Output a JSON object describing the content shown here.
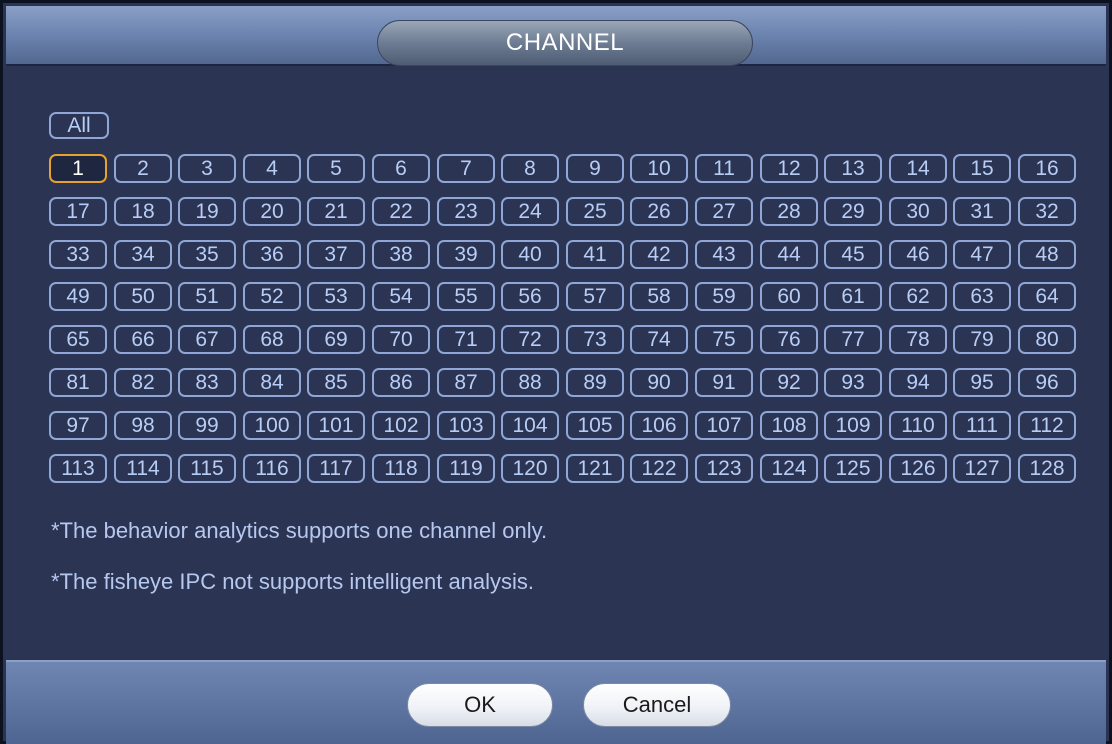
{
  "dialog": {
    "title": "CHANNEL"
  },
  "channels": {
    "all_label": "All",
    "selected": "1",
    "labels": [
      "1",
      "2",
      "3",
      "4",
      "5",
      "6",
      "7",
      "8",
      "9",
      "10",
      "11",
      "12",
      "13",
      "14",
      "15",
      "16",
      "17",
      "18",
      "19",
      "20",
      "21",
      "22",
      "23",
      "24",
      "25",
      "26",
      "27",
      "28",
      "29",
      "30",
      "31",
      "32",
      "33",
      "34",
      "35",
      "36",
      "37",
      "38",
      "39",
      "40",
      "41",
      "42",
      "43",
      "44",
      "45",
      "46",
      "47",
      "48",
      "49",
      "50",
      "51",
      "52",
      "53",
      "54",
      "55",
      "56",
      "57",
      "58",
      "59",
      "60",
      "61",
      "62",
      "63",
      "64",
      "65",
      "66",
      "67",
      "68",
      "69",
      "70",
      "71",
      "72",
      "73",
      "74",
      "75",
      "76",
      "77",
      "78",
      "79",
      "80",
      "81",
      "82",
      "83",
      "84",
      "85",
      "86",
      "87",
      "88",
      "89",
      "90",
      "91",
      "92",
      "93",
      "94",
      "95",
      "96",
      "97",
      "98",
      "99",
      "100",
      "101",
      "102",
      "103",
      "104",
      "105",
      "106",
      "107",
      "108",
      "109",
      "110",
      "111",
      "112",
      "113",
      "114",
      "115",
      "116",
      "117",
      "118",
      "119",
      "120",
      "121",
      "122",
      "123",
      "124",
      "125",
      "126",
      "127",
      "128"
    ]
  },
  "notes": {
    "behavior": "*The behavior analytics supports one channel only.",
    "fisheye": "*The fisheye IPC not supports intelligent analysis."
  },
  "footer": {
    "ok_label": "OK",
    "cancel_label": "Cancel"
  },
  "colors": {
    "background": "#2b3452",
    "button_border": "#8fa6d6",
    "selected_border": "#e7a12e",
    "text": "#b8cdf6"
  }
}
